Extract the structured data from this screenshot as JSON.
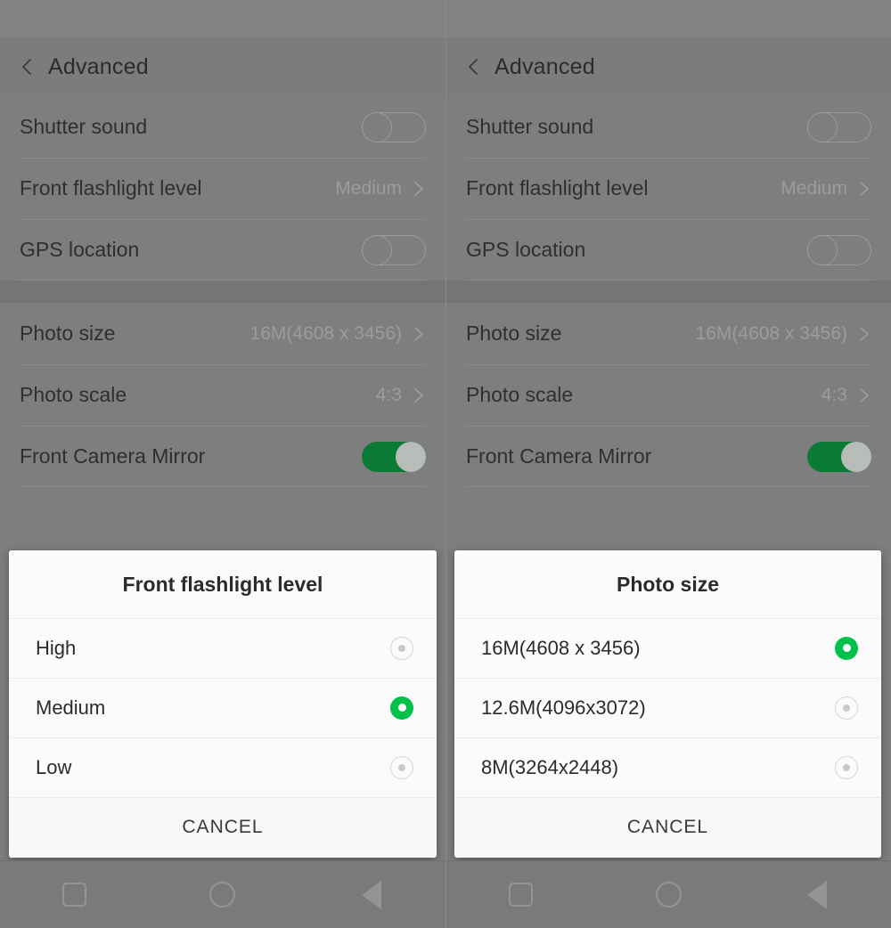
{
  "app": {
    "header_title": "Advanced",
    "back_icon": "chevron-left-icon"
  },
  "settings": {
    "group1": [
      {
        "label": "Shutter sound",
        "control": "toggle",
        "state": "off"
      },
      {
        "label": "Front flashlight level",
        "control": "chevron",
        "value": "Medium"
      },
      {
        "label": "GPS location",
        "control": "toggle",
        "state": "off"
      }
    ],
    "group2": [
      {
        "label": "Photo size",
        "control": "chevron",
        "value": "16M(4608 x 3456)"
      },
      {
        "label": "Photo scale",
        "control": "chevron",
        "value": "4:3"
      },
      {
        "label": "Front Camera Mirror",
        "control": "toggle",
        "state": "on"
      }
    ]
  },
  "dialog_left": {
    "title": "Front flashlight level",
    "options": [
      {
        "label": "High",
        "selected": false
      },
      {
        "label": "Medium",
        "selected": true
      },
      {
        "label": "Low",
        "selected": false
      }
    ],
    "cancel_label": "CANCEL"
  },
  "dialog_right": {
    "title": "Photo size",
    "options": [
      {
        "label": "16M(4608 x 3456)",
        "selected": true
      },
      {
        "label": "12.6M(4096x3072)",
        "selected": false
      },
      {
        "label": "8M(3264x2448)",
        "selected": false
      }
    ],
    "cancel_label": "CANCEL"
  },
  "navbar": {
    "recents_icon": "square-icon",
    "home_icon": "circle-icon",
    "back_icon": "triangle-left-icon"
  },
  "colors": {
    "accent_green": "#00c24a",
    "toggle_on_green": "#0b7a35",
    "scrim_gray": "#7e7e7e",
    "dialog_bg": "#fafafa"
  }
}
